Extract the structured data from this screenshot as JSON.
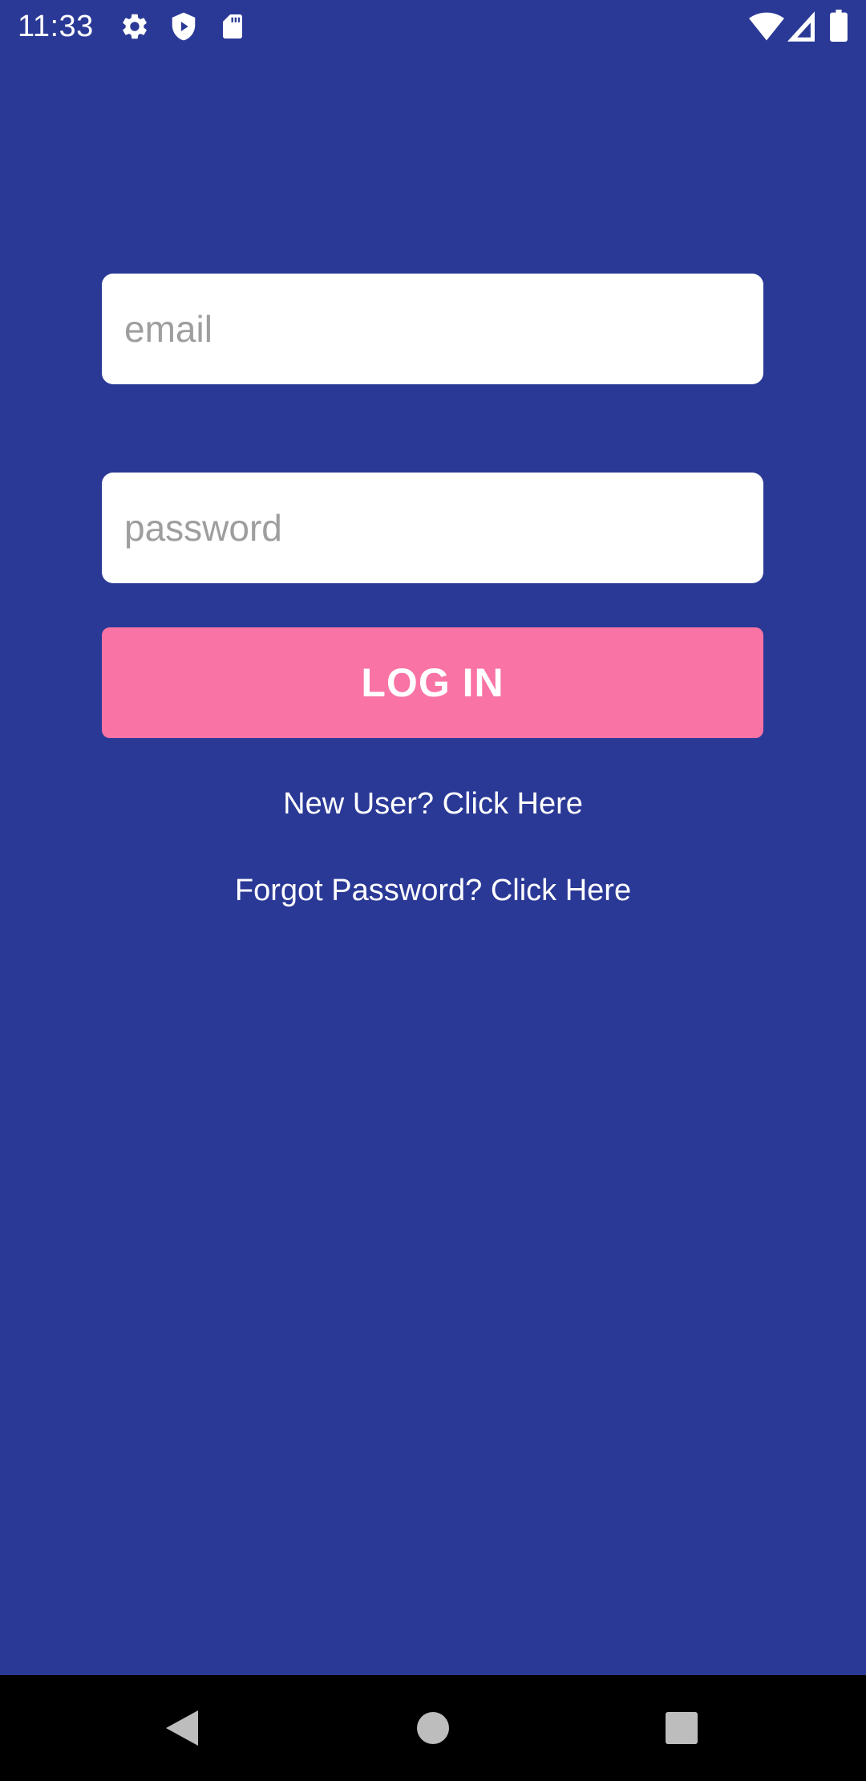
{
  "status_bar": {
    "time": "11:33",
    "left_icons": [
      "gear-icon",
      "shield-play-icon",
      "sd-card-icon"
    ],
    "right_icons": [
      "wifi-icon",
      "cellular-signal-icon",
      "battery-icon"
    ]
  },
  "login": {
    "email_placeholder": "email",
    "password_placeholder": "password",
    "login_label": "LOG IN",
    "new_user_link": "New User? Click Here",
    "forgot_password_link": "Forgot Password? Click Here"
  },
  "nav_bar": {
    "icons": [
      "back-icon",
      "home-icon",
      "recents-icon"
    ]
  },
  "colors": {
    "background": "#2a3996",
    "button": "#f973a5",
    "input_background": "#ffffff",
    "placeholder": "#9e9e9e",
    "nav_bar": "#000000"
  }
}
